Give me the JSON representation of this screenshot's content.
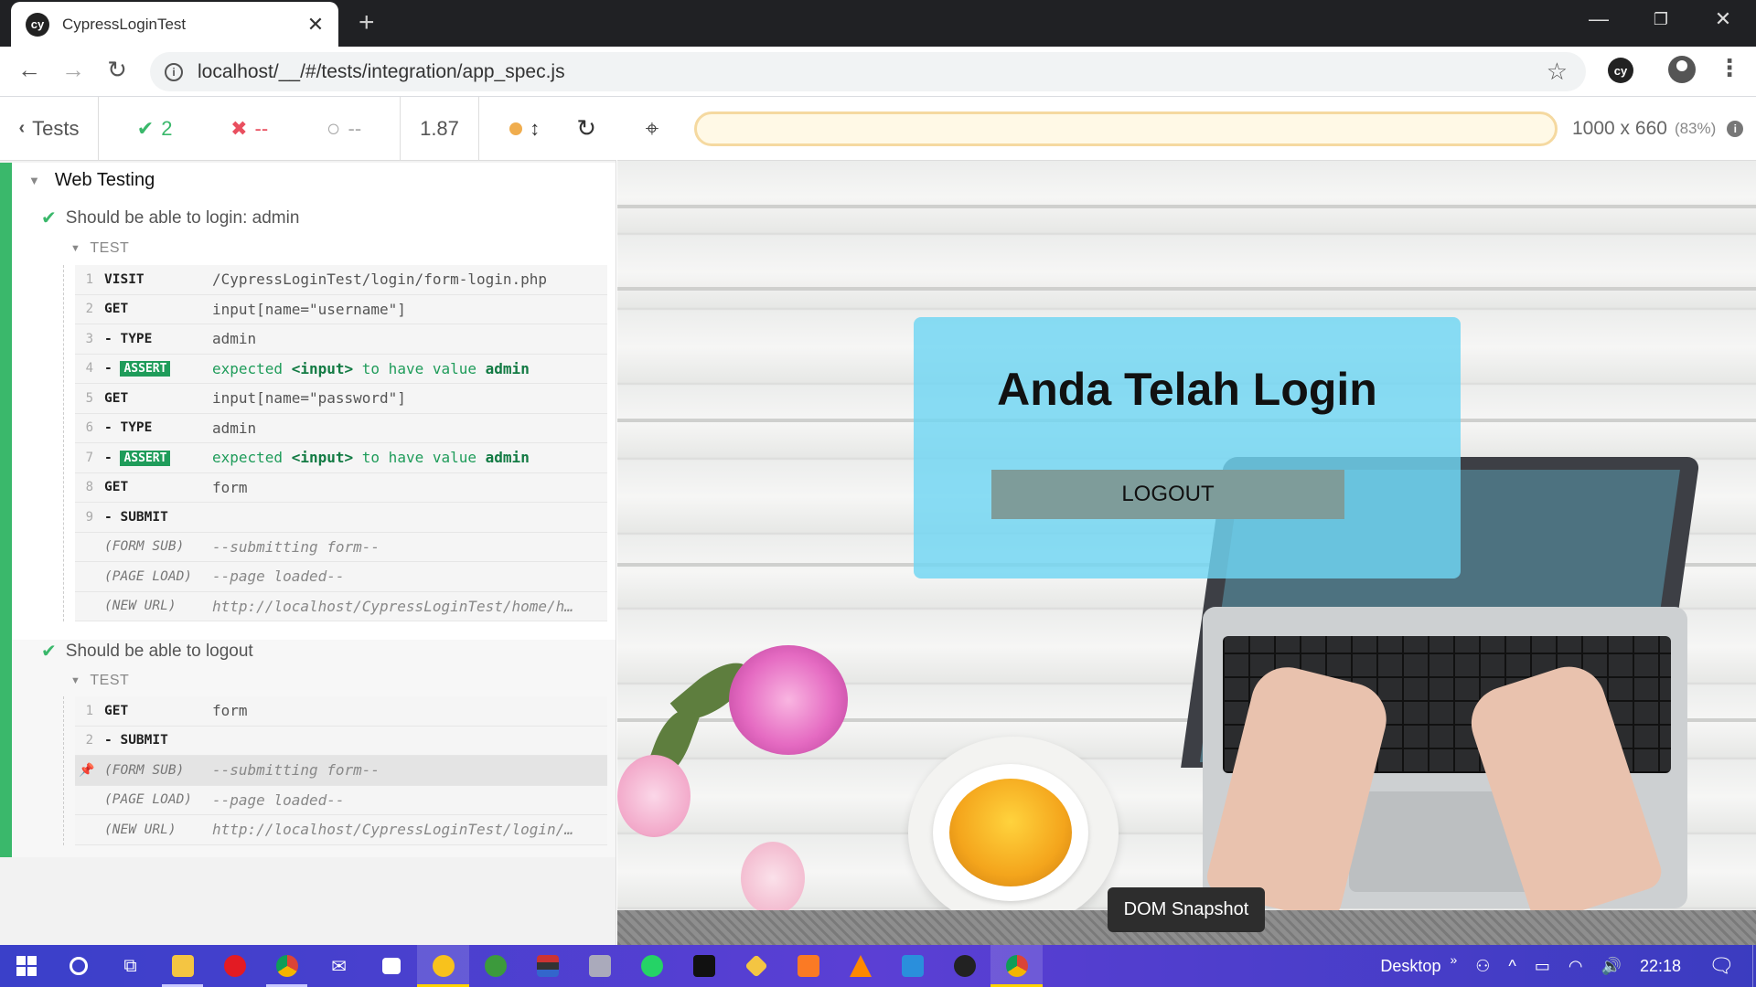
{
  "browser": {
    "tab_title": "CypressLoginTest",
    "favicon": "cy",
    "url": "localhost/__/#/tests/integration/app_spec.js",
    "extension_label": "cy"
  },
  "reporter": {
    "tests_label": "Tests",
    "passed": "2",
    "failed": "--",
    "pending": "--",
    "duration": "1.87",
    "suite_title": "Web Testing",
    "tests": [
      {
        "title": "Should be able to login: admin",
        "hook": "TEST",
        "commands": [
          {
            "num": "1",
            "name": "VISIT",
            "msg": "/CypressLoginTest/login/form-login.php"
          },
          {
            "num": "2",
            "name": "GET",
            "msg": "input[name=\"username\"]"
          },
          {
            "num": "3",
            "name": "TYPE",
            "msg": "admin"
          },
          {
            "num": "4",
            "name": "ASSERT",
            "msg_pre": "expected",
            "msg_el": "<input>",
            "msg_mid": "to have value",
            "msg_val": "admin"
          },
          {
            "num": "5",
            "name": "GET",
            "msg": "input[name=\"password\"]"
          },
          {
            "num": "6",
            "name": "TYPE",
            "msg": "admin"
          },
          {
            "num": "7",
            "name": "ASSERT",
            "msg_pre": "expected",
            "msg_el": "<input>",
            "msg_mid": "to have value",
            "msg_val": "admin"
          },
          {
            "num": "8",
            "name": "GET",
            "msg": "form"
          },
          {
            "num": "9",
            "name": "SUBMIT",
            "msg": ""
          },
          {
            "num": "",
            "name": "(FORM SUB)",
            "msg": "--submitting form--"
          },
          {
            "num": "",
            "name": "(PAGE LOAD)",
            "msg": "--page loaded--"
          },
          {
            "num": "",
            "name": "(NEW URL)",
            "msg": "http://localhost/CypressLoginTest/home/h…"
          }
        ]
      },
      {
        "title": "Should be able to logout",
        "hook": "TEST",
        "commands": [
          {
            "num": "1",
            "name": "GET",
            "msg": "form"
          },
          {
            "num": "2",
            "name": "SUBMIT",
            "msg": ""
          },
          {
            "num": "",
            "name": "(FORM SUB)",
            "msg": "--submitting form--"
          },
          {
            "num": "",
            "name": "(PAGE LOAD)",
            "msg": "--page loaded--"
          },
          {
            "num": "",
            "name": "(NEW URL)",
            "msg": "http://localhost/CypressLoginTest/login/…"
          }
        ]
      }
    ]
  },
  "aut": {
    "viewport_size": "1000 x 660",
    "viewport_scale": "(83%)",
    "page_heading": "Anda Telah Login",
    "logout_label": "LOGOUT",
    "snapshot_label": "DOM Snapshot"
  },
  "taskbar": {
    "desktop_label": "Desktop",
    "chevron": "»",
    "time": "22:18",
    "apps": [
      "windows-start-icon",
      "cortana-icon",
      "task-view-icon",
      "file-explorer-icon",
      "opera-icon",
      "chrome-icon",
      "mail-icon",
      "store-icon",
      "xampp-app-icon",
      "globe-app-icon",
      "flags-app-icon",
      "tool-app-icon",
      "whatsapp-icon",
      "terminal-icon",
      "git-icon",
      "xampp-icon",
      "vlc-icon",
      "vscode-icon",
      "cypress-icon",
      "chrome-active-icon"
    ]
  }
}
